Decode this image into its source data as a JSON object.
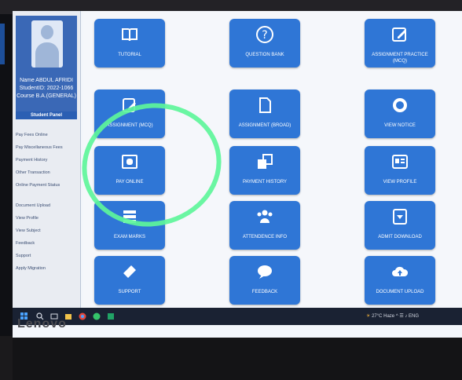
{
  "profile": {
    "name_line": "Name ABDUL AFRIDI",
    "student_id_line": "StudentID: 2022-1066",
    "course_line": "Course B.A.(GENERAL)"
  },
  "sidebar": {
    "panel_title": "Student Panel",
    "items": [
      {
        "label": "Pay Fees Online"
      },
      {
        "label": "Pay Miscellaneous Fees"
      },
      {
        "label": "Payment History"
      },
      {
        "label": "Other Transaction"
      },
      {
        "label": "Online Payment Status"
      }
    ],
    "items2": [
      {
        "label": "Document Upload"
      },
      {
        "label": "View Profile"
      },
      {
        "label": "View Subject"
      },
      {
        "label": "Feedback"
      },
      {
        "label": "Support"
      },
      {
        "label": "Apply Migration"
      }
    ]
  },
  "tiles": [
    {
      "label": "TUTORIAL",
      "icon": "book-icon"
    },
    {
      "label": "QUESTION BANK",
      "icon": "question-icon"
    },
    {
      "label": "ASSIGNMENT PRACTICE (MCQ)",
      "icon": "edit-icon"
    },
    {
      "label": "ASSIGNMENT (MCQ)",
      "icon": "pencil-icon"
    },
    {
      "label": "ASSIGNMENT (BROAD)",
      "icon": "document-icon"
    },
    {
      "label": "VIEW NOTICE",
      "icon": "eye-icon"
    },
    {
      "label": "PAY ONLINE",
      "icon": "money-icon"
    },
    {
      "label": "PAYMENT HISTORY",
      "icon": "copy-icon"
    },
    {
      "label": "VIEW PROFILE",
      "icon": "id-card-icon"
    },
    {
      "label": "EXAM MARKS",
      "icon": "list-icon"
    },
    {
      "label": "ATTENDENCE INFO",
      "icon": "people-icon"
    },
    {
      "label": "ADMIT DOWNLOAD",
      "icon": "download-icon"
    },
    {
      "label": "SUPPORT",
      "icon": "ticket-icon"
    },
    {
      "label": "FEEDBACK",
      "icon": "chat-icon"
    },
    {
      "label": "DOCUMENT UPLOAD",
      "icon": "upload-cloud-icon"
    }
  ],
  "taskbar": {
    "weather": "27°C Haze",
    "lang": "ENG"
  },
  "laptop": {
    "brand": "Lenovo"
  },
  "colors": {
    "tile_blue": "#2f76d6",
    "annotation_green": "#5df59a",
    "profile_blue": "#3a68b6"
  }
}
